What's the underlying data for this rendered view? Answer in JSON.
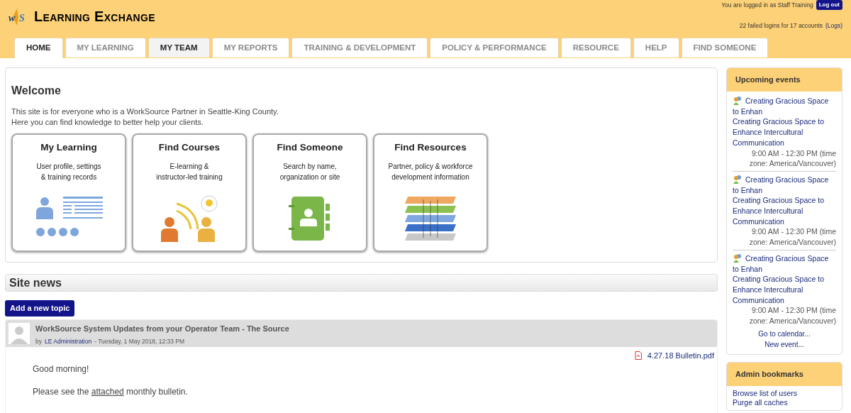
{
  "header": {
    "logo": [
      "w",
      "S"
    ],
    "site_title": "Learning Exchange",
    "login_text": "You are logged in as Staff Training",
    "logout_button": "Log out",
    "failed_logins": "22 failed logins for 17 accounts",
    "logs_link": "(Logs)"
  },
  "tabs": [
    {
      "label": "HOME",
      "selected": true,
      "highlighted": false
    },
    {
      "label": "MY LEARNING",
      "selected": false,
      "highlighted": false
    },
    {
      "label": "MY TEAM",
      "selected": false,
      "highlighted": true
    },
    {
      "label": "MY REPORTS",
      "selected": false,
      "highlighted": false
    },
    {
      "label": "TRAINING & DEVELOPMENT",
      "selected": false,
      "highlighted": false
    },
    {
      "label": "POLICY & PERFORMANCE",
      "selected": false,
      "highlighted": false
    },
    {
      "label": "RESOURCE",
      "selected": false,
      "highlighted": false
    },
    {
      "label": "HELP",
      "selected": false,
      "highlighted": false
    },
    {
      "label": "FIND SOMEONE",
      "selected": false,
      "highlighted": false
    }
  ],
  "welcome": {
    "title": "Welcome",
    "lines": [
      "This site is for everyone who is a WorkSource Partner in Seattle-King County.",
      "Here you can find knowledge to better help your clients."
    ],
    "cards": [
      {
        "kind": "learning",
        "title": "My Learning",
        "lines": [
          "User profile, settings",
          "& training records"
        ]
      },
      {
        "kind": "courses",
        "title": "Find Courses",
        "lines": [
          "E-learning &",
          "instructor-led training"
        ]
      },
      {
        "kind": "someone",
        "title": "Find Someone",
        "lines": [
          "Search by name,",
          "organization or site"
        ]
      },
      {
        "kind": "resources",
        "title": "Find Resources",
        "lines": [
          "Partner, policy & workforce",
          "development information"
        ]
      }
    ]
  },
  "site_news": {
    "title": "Site news",
    "add_button": "Add a new topic",
    "post": {
      "title": "WorkSource System Updates from your Operator Team - The Source",
      "by": "by",
      "author": "LE Administration",
      "date": "- Tuesday, 1 May 2018, 12:33 PM",
      "attachment": "4.27.18 Bulletin.pdf",
      "greeting": "Good morning!",
      "body_before": "Please see the",
      "body_link": "attached",
      "body_after": "monthly bulletin."
    }
  },
  "sidebar": {
    "events": {
      "title": "Upcoming events",
      "items": [
        {
          "short": "Creating Gracious Space to Enhan",
          "full": "Creating Gracious Space to Enhance Intercultural Communication",
          "time": "9:00 AM - 12:30 PM (time zone: America/Vancouver)"
        },
        {
          "short": "Creating Gracious Space to Enhan",
          "full": "Creating Gracious Space to Enhance Intercultural Communication",
          "time": "9:00 AM - 12:30 PM (time zone: America/Vancouver)"
        },
        {
          "short": "Creating Gracious Space to Enhan",
          "full": "Creating Gracious Space to Enhance Intercultural Communication",
          "time": "9:00 AM - 12:30 PM (time zone: America/Vancouver)"
        }
      ],
      "links": [
        "Go to calendar...",
        "New event..."
      ]
    },
    "bookmarks": {
      "title": "Admin bookmarks",
      "links": [
        "Browse list of users",
        "Purge all caches"
      ]
    }
  }
}
